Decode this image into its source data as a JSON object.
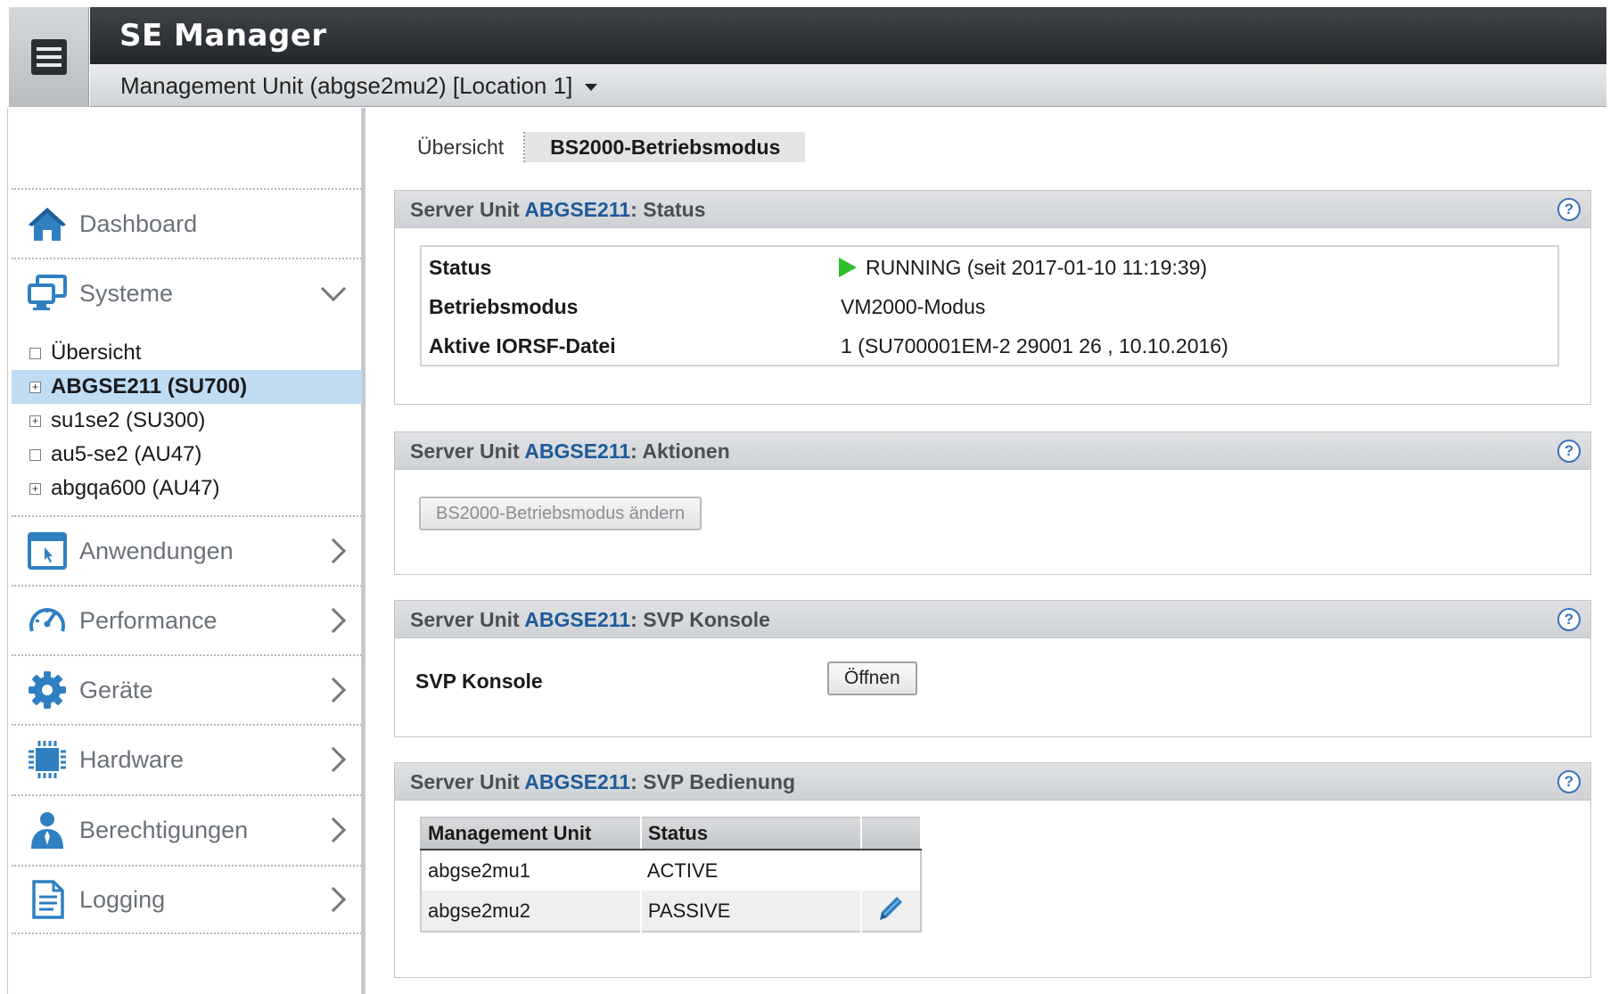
{
  "app": {
    "title": "SE Manager",
    "unit_selector": "Management Unit (abgse2mu2) [Location 1]"
  },
  "sidebar": {
    "nav": [
      {
        "label": "Dashboard",
        "icon": "home-icon"
      },
      {
        "label": "Systeme",
        "icon": "monitor-icon",
        "expanded": true
      },
      {
        "label": "Anwendungen",
        "icon": "application-window-icon"
      },
      {
        "label": "Performance",
        "icon": "gauge-icon"
      },
      {
        "label": "Geräte",
        "icon": "gear-icon"
      },
      {
        "label": "Hardware",
        "icon": "chip-icon"
      },
      {
        "label": "Berechtigungen",
        "icon": "user-icon"
      },
      {
        "label": "Logging",
        "icon": "document-icon"
      }
    ],
    "tree": [
      {
        "label": "Übersicht",
        "expander": ""
      },
      {
        "label": "ABGSE211 (SU700)",
        "expander": "+",
        "selected": true
      },
      {
        "label": "su1se2 (SU300)",
        "expander": "+"
      },
      {
        "label": "au5-se2 (AU47)",
        "expander": ""
      },
      {
        "label": "abgqa600 (AU47)",
        "expander": "+"
      }
    ]
  },
  "tabs": [
    {
      "label": "Übersicht",
      "active": false
    },
    {
      "label": "BS2000-Betriebsmodus",
      "active": true
    }
  ],
  "panels": {
    "prefix": "Server Unit",
    "unit": "ABGSE211",
    "status": {
      "title": "Status",
      "rows": [
        {
          "key": "Status",
          "value": "RUNNING (seit 2017-01-10 11:19:39)"
        },
        {
          "key": "Betriebsmodus",
          "value": "VM2000-Modus"
        },
        {
          "key": "Aktive IORSF-Datei",
          "value": "1 (SU700001EM-2 29001 26 , 10.10.2016)"
        }
      ]
    },
    "actions": {
      "title": "Aktionen",
      "button": "BS2000-Betriebsmodus ändern"
    },
    "console": {
      "title": "SVP Konsole",
      "label": "SVP Konsole",
      "button": "Öffnen"
    },
    "operation": {
      "title": "SVP Bedienung",
      "columns": [
        "Management Unit",
        "Status",
        ""
      ],
      "rows": [
        {
          "unit": "abgse2mu1",
          "status": "ACTIVE",
          "editable": false
        },
        {
          "unit": "abgse2mu2",
          "status": "PASSIVE",
          "editable": true
        }
      ]
    }
  },
  "colors": {
    "link": "#1e5a9a",
    "selected_row": "#bfdcf3",
    "running": "#2fbf2a",
    "help": "#3b73b5"
  }
}
